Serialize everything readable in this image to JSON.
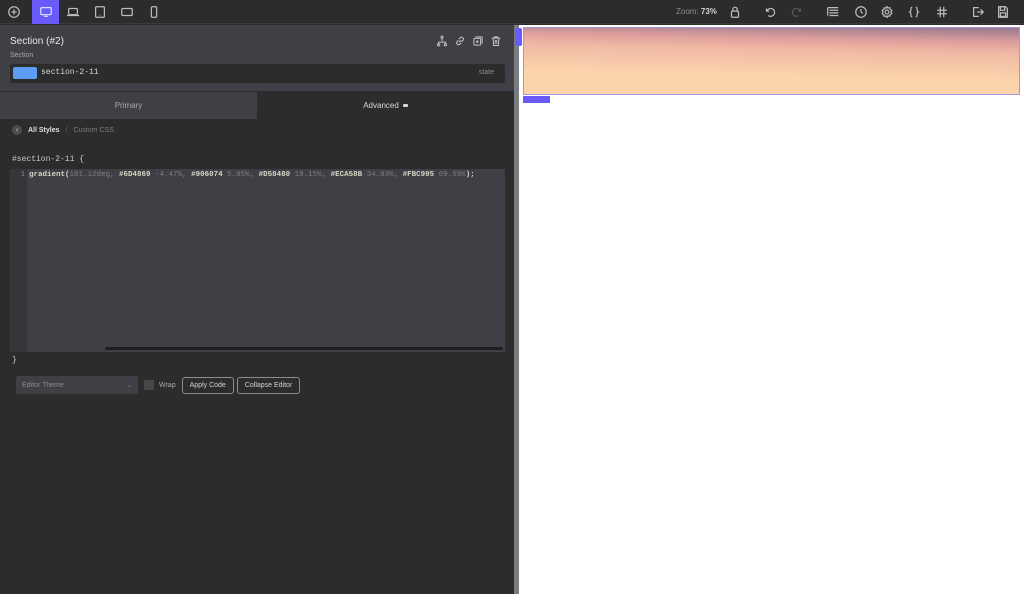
{
  "toolbar": {
    "add_icon": "plus-circle-icon",
    "devices": [
      {
        "name": "desktop",
        "icon": "monitor-icon",
        "active": true
      },
      {
        "name": "laptop",
        "icon": "laptop-icon",
        "active": false
      },
      {
        "name": "tablet-portrait",
        "icon": "tablet-icon",
        "active": false
      },
      {
        "name": "tablet-landscape",
        "icon": "tablet-landscape-icon",
        "active": false
      },
      {
        "name": "mobile",
        "icon": "phone-icon",
        "active": false
      }
    ],
    "zoom_label": "Zoom:",
    "zoom_value": "73%",
    "right_icons": [
      "lock-icon",
      "undo-icon",
      "redo-icon",
      "structure-icon",
      "history-icon",
      "settings-icon",
      "braces-icon",
      "hash-icon",
      "exit-icon",
      "save-icon"
    ]
  },
  "panel": {
    "title": "Section (#2)",
    "subtitle": "Section",
    "selector_id": "section-2-11",
    "state_label": "state",
    "tabs": [
      {
        "label": "Primary",
        "active": false
      },
      {
        "label": "Advanced",
        "active": true
      }
    ],
    "breadcrumb": {
      "back": "‹",
      "all_styles": "All Styles",
      "separator": "/",
      "current": "Custom CSS"
    },
    "css_selector_open": "#section-2-11 {",
    "css_selector_close": "}",
    "code": {
      "line_number": "1",
      "fn": "gradient(",
      "angle": "181.12deg, ",
      "stops": [
        {
          "hex": "#6D4869",
          "pos": " -4.47%, "
        },
        {
          "hex": "#906074",
          "pos": " 5.05%, "
        },
        {
          "hex": "#D58480",
          "pos": " 19.15%, "
        },
        {
          "hex": "#ECA58B",
          "pos": " 34.03%, "
        },
        {
          "hex": "#FBC995",
          "pos": " 69.69%"
        }
      ],
      "end": ");"
    },
    "controls": {
      "theme_placeholder": "Editor Theme",
      "wrap_label": "Wrap",
      "apply_label": "Apply Code",
      "collapse_label": "Collapse Editor"
    }
  },
  "colors": {
    "accent": "#6a5af9",
    "selector_chip": "#5d9df5"
  }
}
